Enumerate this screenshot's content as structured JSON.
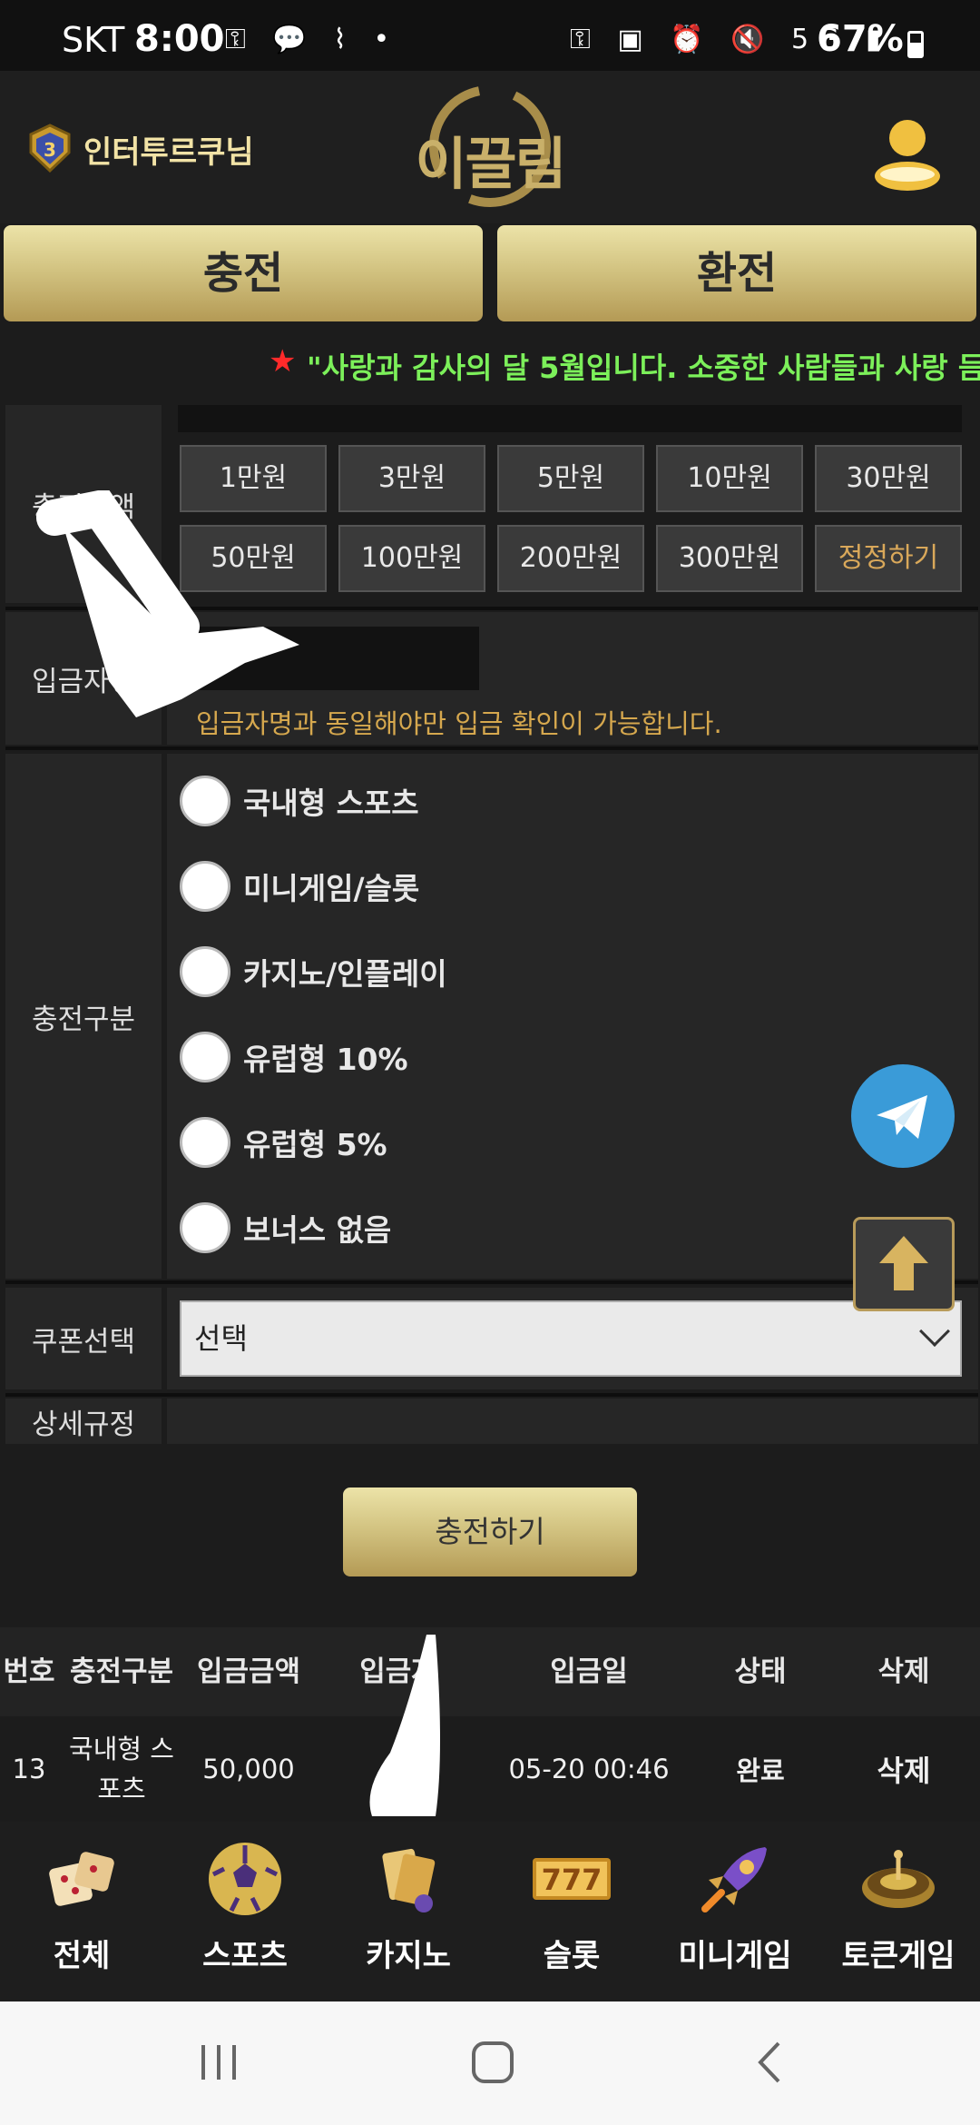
{
  "status_bar": {
    "carrier": "SKT",
    "time": "8:00",
    "battery": "67%",
    "left_icons": "⚿ 💬 ⌇ •",
    "right_icons": "⚿ ▣ ⏰ 🔇 5G ▮"
  },
  "header": {
    "user_name": "인터투르쿠님",
    "logo_text": "이끌림"
  },
  "actions": {
    "charge": "충전",
    "exchange": "환전"
  },
  "ticker": {
    "star": "★",
    "message": "\"사랑과 감사의 달 5월입니다. 소중한 사람들과 사랑 듬"
  },
  "form": {
    "amount_label": "충전금액",
    "amount_buttons": [
      "1만원",
      "3만원",
      "5만원",
      "10만원",
      "30만원",
      "50만원",
      "100만원",
      "200만원",
      "300만원"
    ],
    "amount_reset": "정정하기",
    "depositor_label": "입금자명",
    "depositor_notice": "입금자명과 동일해야만 입금 확인이 가능합니다.",
    "type_label": "충전구분",
    "types": [
      "국내형 스포츠",
      "미니게임/슬롯",
      "카지노/인플레이",
      "유럽형 10%",
      "유럽형 5%",
      "보너스 없음"
    ],
    "coupon_label": "쿠폰선택",
    "coupon_value": "선택",
    "rules_label": "상세규정",
    "submit": "충전하기"
  },
  "table": {
    "headers": [
      "번호",
      "충전구분",
      "입금금액",
      "입금자",
      "입금일",
      "상태",
      "삭제"
    ],
    "rows": [
      {
        "no": "13",
        "type": "국내형 스포츠",
        "amount": "50,000",
        "depositor": "",
        "date": "05-20 00:46",
        "status": "완료",
        "delete": "삭제"
      }
    ]
  },
  "game_nav": [
    {
      "label": "전체",
      "icon": "dice-icon"
    },
    {
      "label": "스포츠",
      "icon": "soccer-ball-icon"
    },
    {
      "label": "카지노",
      "icon": "casino-cards-icon"
    },
    {
      "label": "슬롯",
      "icon": "slot-777-icon"
    },
    {
      "label": "미니게임",
      "icon": "rocket-icon"
    },
    {
      "label": "토큰게임",
      "icon": "roulette-icon"
    }
  ],
  "colors": {
    "gold": "#d3c482",
    "ticker_green": "#7cf05a",
    "notice_orange": "#d6a84e",
    "telegram_blue": "#3a9bd8"
  }
}
